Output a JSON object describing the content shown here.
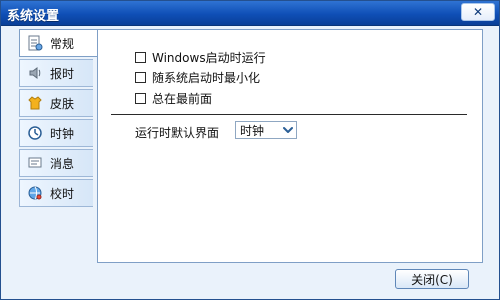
{
  "window": {
    "title": "系统设置",
    "close_glyph": "✕"
  },
  "tabs": [
    {
      "label": "常规",
      "icon": "settings-doc-icon",
      "active": true
    },
    {
      "label": "报时",
      "icon": "speaker-icon",
      "active": false
    },
    {
      "label": "皮肤",
      "icon": "shirt-icon",
      "active": false
    },
    {
      "label": "时钟",
      "icon": "clock-icon",
      "active": false
    },
    {
      "label": "消息",
      "icon": "message-icon",
      "active": false
    },
    {
      "label": "校时",
      "icon": "sync-globe-icon",
      "active": false
    }
  ],
  "general": {
    "options": [
      {
        "label": "Windows启动时运行",
        "checked": false
      },
      {
        "label": "随系统启动时最小化",
        "checked": false
      },
      {
        "label": "总在最前面",
        "checked": false
      }
    ],
    "default_view_label": "运行时默认界面",
    "default_view_value": "时钟"
  },
  "footer": {
    "close_button": "关闭(C)"
  },
  "colors": {
    "titlebar": "#1f5fc7",
    "accent": "#7f9fc6",
    "panel_bg": "#ffffff"
  }
}
